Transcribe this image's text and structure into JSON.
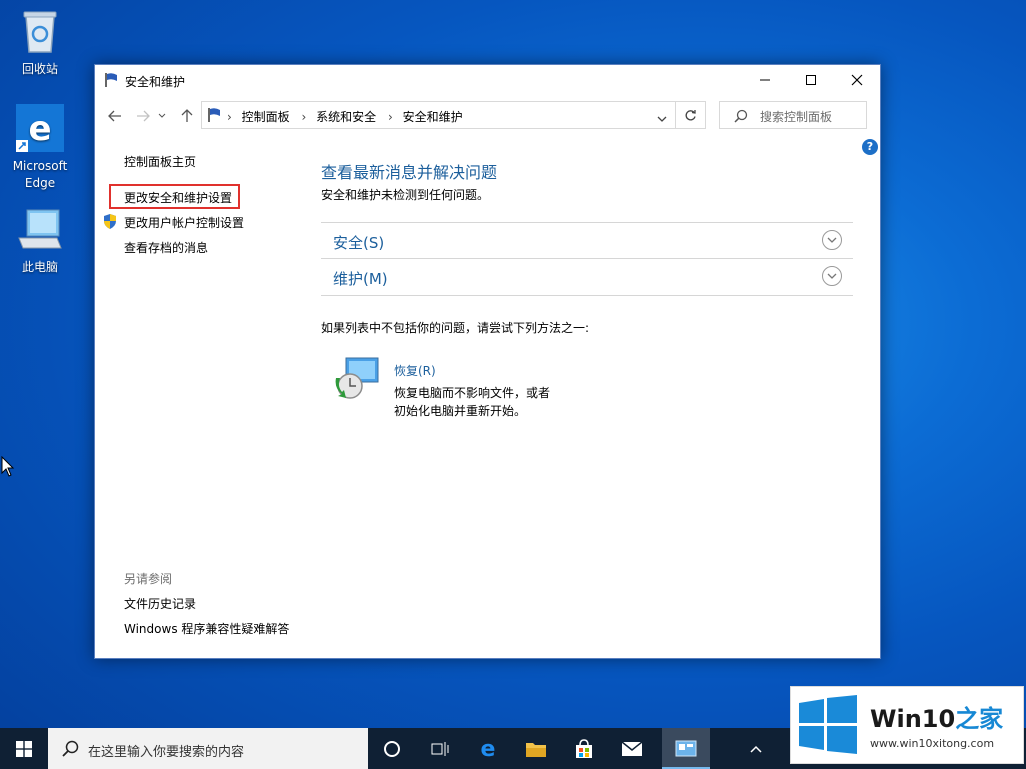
{
  "desktop": {
    "icons": [
      {
        "label": "回收站"
      },
      {
        "label": "Microsoft Edge"
      },
      {
        "label": "此电脑"
      }
    ]
  },
  "window": {
    "title": "安全和维护",
    "breadcrumbs": [
      "控制面板",
      "系统和安全",
      "安全和维护"
    ],
    "search_placeholder": "搜索控制面板"
  },
  "sidebar": {
    "home": "控制面板主页",
    "items": [
      {
        "label": "更改安全和维护设置",
        "highlighted": true
      },
      {
        "label": "更改用户帐户控制设置",
        "icon": "uac-shield-icon"
      },
      {
        "label": "查看存档的消息"
      }
    ],
    "see_also_heading": "另请参阅",
    "see_also": [
      "文件历史记录",
      "Windows 程序兼容性疑难解答"
    ]
  },
  "main": {
    "title": "查看最新消息并解决问题",
    "subtitle": "安全和维护未检测到任何问题。",
    "sections": [
      {
        "label": "安全(S)"
      },
      {
        "label": "维护(M)"
      }
    ],
    "hint": "如果列表中不包括你的问题，请尝试下列方法之一:",
    "recovery": {
      "link": "恢复(R)",
      "desc_line1": "恢复电脑而不影响文件，或者",
      "desc_line2": "初始化电脑并重新开始。"
    }
  },
  "taskbar": {
    "search_placeholder": "在这里输入你要搜索的内容"
  },
  "watermark": {
    "brand_main": "Win10",
    "brand_accent": "之家",
    "url": "www.win10xitong.com"
  },
  "colors": {
    "accent_link": "#1c5f9c",
    "highlight_box": "#e0312d",
    "taskbar": "#0f2034"
  }
}
